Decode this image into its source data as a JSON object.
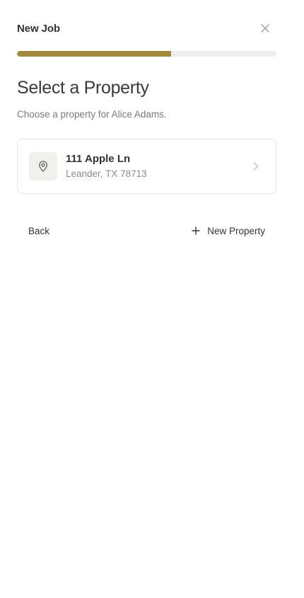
{
  "header": {
    "title": "New Job",
    "close_icon": "close-icon"
  },
  "progress": {
    "fraction": 0.595,
    "fill_color": "#a2893a",
    "track_color": "#eeeeee"
  },
  "main": {
    "heading": "Select a Property",
    "subheading": "Choose a property for Alice Adams."
  },
  "property": {
    "street": "111 Apple Ln",
    "city_line": "Leander, TX 78713",
    "icon": "location-pin-icon",
    "chevron_icon": "chevron-right-icon"
  },
  "actions": {
    "back_label": "Back",
    "new_property_label": "New Property",
    "new_property_icon": "plus-icon"
  }
}
